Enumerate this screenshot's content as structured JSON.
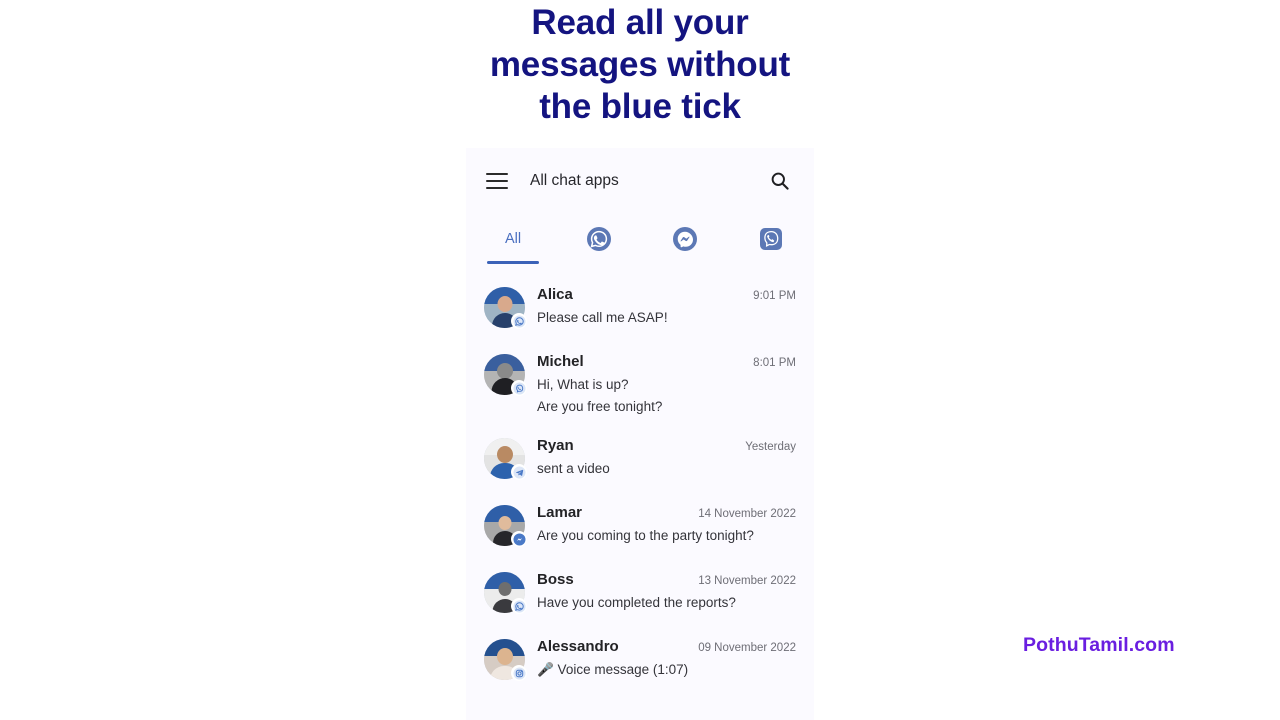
{
  "headline": {
    "lines": [
      "Read all your",
      "messages without",
      "the blue tick"
    ],
    "color": "#141480"
  },
  "phone": {
    "background": "#fbfaff",
    "appbar": {
      "menu_icon": "hamburger-menu-icon",
      "title": "All chat apps",
      "search_icon": "search-icon"
    },
    "tabs": {
      "accent_color": "#3b62b8",
      "items": [
        {
          "label": "All",
          "icon": "",
          "type": "text",
          "selected": true
        },
        {
          "label": "",
          "icon": "whatsapp-icon",
          "type": "icon",
          "selected": false
        },
        {
          "label": "",
          "icon": "messenger-icon",
          "type": "icon",
          "selected": false
        },
        {
          "label": "",
          "icon": "viber-icon",
          "type": "icon",
          "selected": false
        }
      ]
    },
    "chats": [
      {
        "name": "Alica",
        "message": "Please call me ASAP!",
        "time": "9:01 PM",
        "badge": "whatsapp-icon"
      },
      {
        "name": "Michel",
        "message": "Hi, What is up?\nAre you free tonight?",
        "message_line1": "Hi, What is up?",
        "message_line2": "Are you free tonight?",
        "time": "8:01 PM",
        "badge": "viber-icon"
      },
      {
        "name": "Ryan",
        "message": "sent a video",
        "time": "Yesterday",
        "badge": "telegram-icon"
      },
      {
        "name": "Lamar",
        "message": "Are you coming to the party tonight?",
        "time": "14 November 2022",
        "badge": "messenger-icon"
      },
      {
        "name": "Boss",
        "message": "Have you completed the reports?",
        "time": "13 November 2022",
        "badge": "whatsapp-icon"
      },
      {
        "name": "Alessandro",
        "message": "🎤 Voice message (1:07)",
        "time": "09 November 2022",
        "badge": "instagram-icon"
      }
    ]
  },
  "watermark": {
    "text": "PothuTamil.com",
    "color": "#6a1ee0"
  }
}
